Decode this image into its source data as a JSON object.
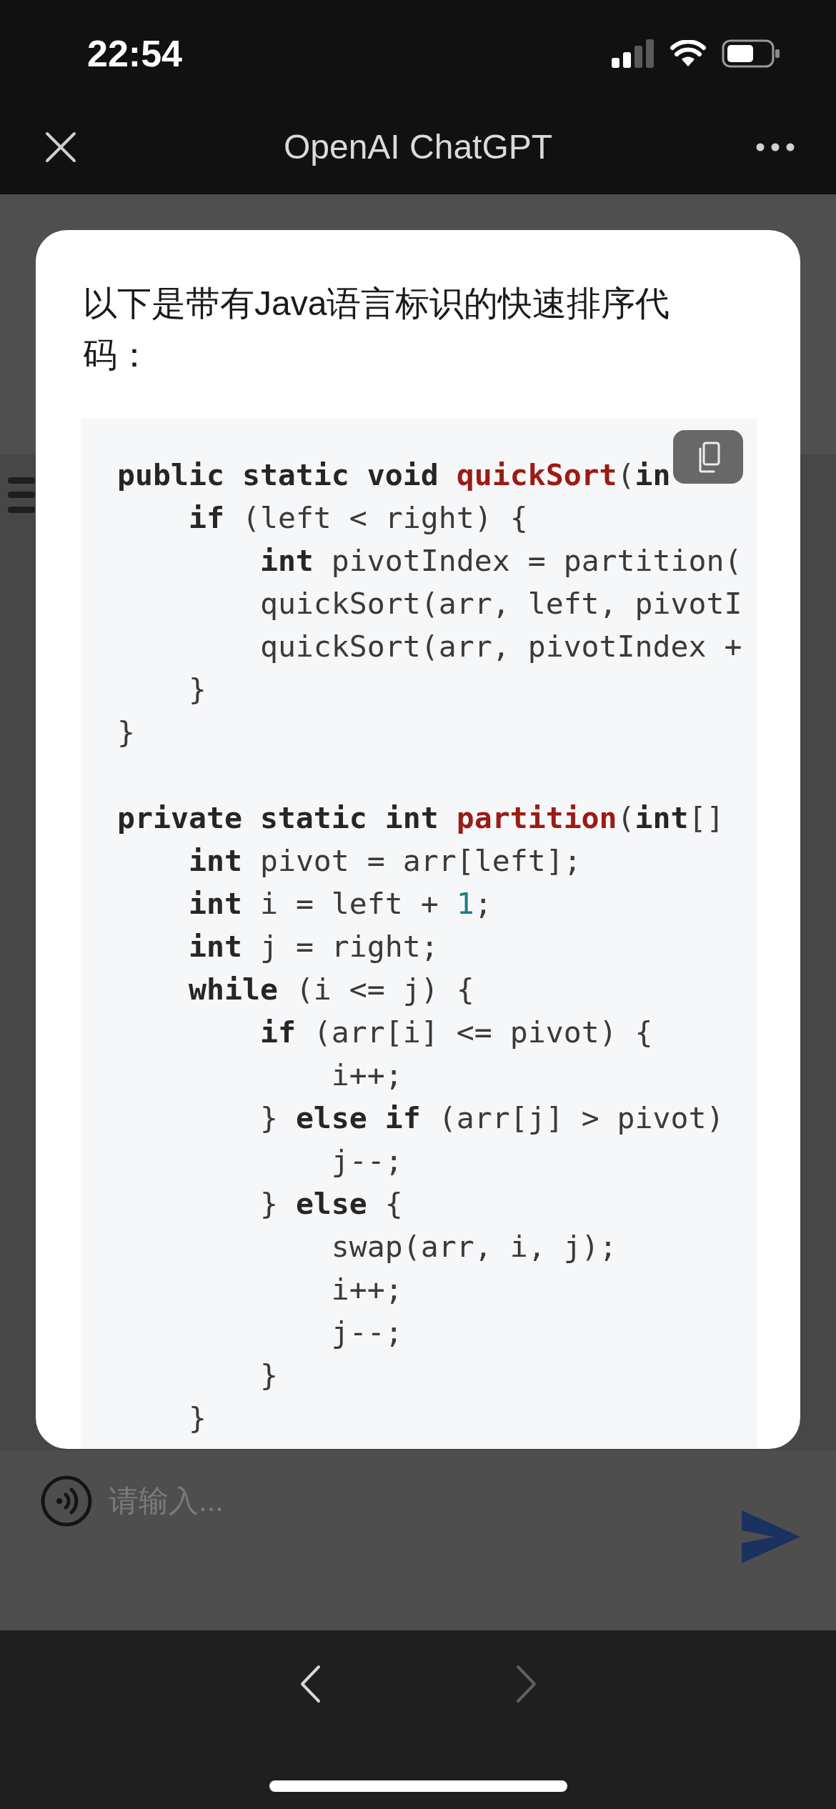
{
  "status_bar": {
    "time": "22:54"
  },
  "nav_bar": {
    "title": "OpenAI ChatGPT"
  },
  "dialog": {
    "heading": "以下是带有Java语言标识的快速排序代码：",
    "code_block": {
      "sections": [
        {
          "lines": [
            {
              "tokens": [
                {
                  "kind": "keyword",
                  "text": "public static void "
                },
                {
                  "kind": "function",
                  "text": "quickSort"
                },
                {
                  "kind": "plain",
                  "text": "("
                },
                {
                  "kind": "keyword",
                  "text": "in"
                }
              ]
            },
            {
              "tokens": [
                {
                  "kind": "keyword",
                  "text": "    if"
                },
                {
                  "kind": "plain",
                  "text": " (left < right) {"
                }
              ]
            },
            {
              "tokens": [
                {
                  "kind": "keyword",
                  "text": "        int"
                },
                {
                  "kind": "plain",
                  "text": " pivotIndex = partition("
                }
              ]
            },
            {
              "tokens": [
                {
                  "kind": "plain",
                  "text": "        quickSort(arr, left, pivotI"
                }
              ]
            },
            {
              "tokens": [
                {
                  "kind": "plain",
                  "text": "        quickSort(arr, pivotIndex +"
                }
              ]
            },
            {
              "tokens": [
                {
                  "kind": "plain",
                  "text": "    }"
                }
              ]
            },
            {
              "tokens": [
                {
                  "kind": "plain",
                  "text": "}"
                }
              ]
            }
          ]
        },
        {
          "lines": [
            {
              "tokens": [
                {
                  "kind": "keyword",
                  "text": "private static int "
                },
                {
                  "kind": "function",
                  "text": "partition"
                },
                {
                  "kind": "plain",
                  "text": "("
                },
                {
                  "kind": "keyword",
                  "text": "int"
                },
                {
                  "kind": "plain",
                  "text": "[]"
                }
              ]
            },
            {
              "tokens": [
                {
                  "kind": "keyword",
                  "text": "    int"
                },
                {
                  "kind": "plain",
                  "text": " pivot = arr[left];"
                }
              ]
            },
            {
              "tokens": [
                {
                  "kind": "keyword",
                  "text": "    int"
                },
                {
                  "kind": "plain",
                  "text": " i = left + "
                },
                {
                  "kind": "number",
                  "text": "1"
                },
                {
                  "kind": "plain",
                  "text": ";"
                }
              ]
            },
            {
              "tokens": [
                {
                  "kind": "keyword",
                  "text": "    int"
                },
                {
                  "kind": "plain",
                  "text": " j = right;"
                }
              ]
            },
            {
              "tokens": [
                {
                  "kind": "keyword",
                  "text": "    while"
                },
                {
                  "kind": "plain",
                  "text": " (i <= j) {"
                }
              ]
            },
            {
              "tokens": [
                {
                  "kind": "keyword",
                  "text": "        if"
                },
                {
                  "kind": "plain",
                  "text": " (arr[i] <= pivot) {"
                }
              ]
            },
            {
              "tokens": [
                {
                  "kind": "plain",
                  "text": "            i++;"
                }
              ]
            },
            {
              "tokens": [
                {
                  "kind": "plain",
                  "text": "        } "
                },
                {
                  "kind": "keyword",
                  "text": "else if"
                },
                {
                  "kind": "plain",
                  "text": " (arr[j] > pivot)"
                }
              ]
            },
            {
              "tokens": [
                {
                  "kind": "plain",
                  "text": "            j--;"
                }
              ]
            },
            {
              "tokens": [
                {
                  "kind": "plain",
                  "text": "        } "
                },
                {
                  "kind": "keyword",
                  "text": "else"
                },
                {
                  "kind": "plain",
                  "text": " {"
                }
              ]
            },
            {
              "tokens": [
                {
                  "kind": "plain",
                  "text": "            swap(arr, i, j);"
                }
              ]
            },
            {
              "tokens": [
                {
                  "kind": "plain",
                  "text": "            i++;"
                }
              ]
            },
            {
              "tokens": [
                {
                  "kind": "plain",
                  "text": "            j--;"
                }
              ]
            },
            {
              "tokens": [
                {
                  "kind": "plain",
                  "text": "        }"
                }
              ]
            },
            {
              "tokens": [
                {
                  "kind": "plain",
                  "text": "    }"
                }
              ]
            }
          ]
        }
      ]
    }
  },
  "input_bar": {
    "placeholder": "请输入..."
  },
  "bottom_bar": {
    "buttons": [
      {
        "kind": "back",
        "disabled": false
      },
      {
        "kind": "forward",
        "disabled": true
      }
    ]
  }
}
